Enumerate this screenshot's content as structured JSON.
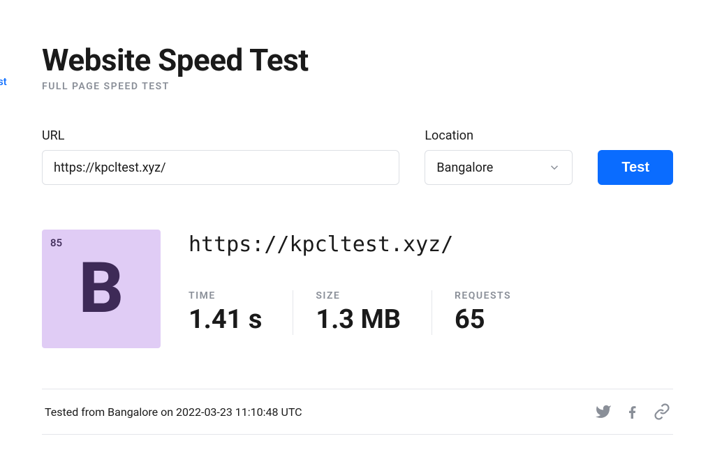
{
  "clipped_link_text": "st",
  "page": {
    "title": "Website Speed Test",
    "subtitle": "FULL PAGE SPEED TEST"
  },
  "form": {
    "url_label": "URL",
    "url_value": "https://kpcltest.xyz/",
    "location_label": "Location",
    "location_value": "Bangalore",
    "test_button": "Test"
  },
  "result": {
    "grade_score": "85",
    "grade_letter": "B",
    "tested_url": "https://kpcltest.xyz/",
    "metrics": {
      "time_label": "TIME",
      "time_value": "1.41 s",
      "size_label": "SIZE",
      "size_value": "1.3 MB",
      "requests_label": "REQUESTS",
      "requests_value": "65"
    }
  },
  "footer": {
    "tested_from": "Tested from Bangalore on 2022-03-23 11:10:48 UTC",
    "icons": {
      "twitter": "twitter-icon",
      "facebook": "facebook-icon",
      "link": "link-icon"
    }
  }
}
